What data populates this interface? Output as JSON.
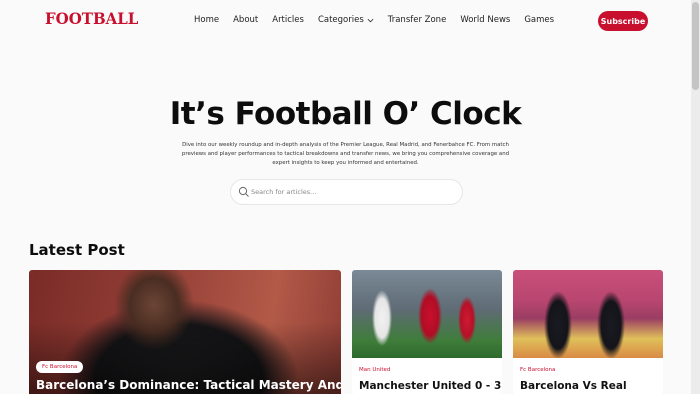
{
  "brand": {
    "logo_text": "FOOTBALL",
    "accent_color": "#c8102e"
  },
  "nav": {
    "items": [
      {
        "label": "Home"
      },
      {
        "label": "About"
      },
      {
        "label": "Articles"
      },
      {
        "label": "Categories",
        "icon": "chevron-down-icon"
      },
      {
        "label": "Transfer Zone"
      },
      {
        "label": "World News"
      },
      {
        "label": "Games"
      }
    ],
    "subscribe_label": "Subscribe"
  },
  "hero": {
    "title": "It’s Football O’ Clock",
    "description": "Dive into our weekly roundup and in-depth analysis of the Premier League, Real Madrid, and Fenerbahce FC. From match previews and player performances to tactical breakdowns and transfer news, we bring you comprehensive coverage and expert insights to keep you informed and entertained.",
    "search": {
      "placeholder": "Search for articles...",
      "icon": "search-icon"
    }
  },
  "latest": {
    "heading": "Latest Post",
    "featured": {
      "tag": "Fc Barcelona",
      "title": "Barcelona’s Dominance: Tactical Mastery And"
    },
    "cards": [
      {
        "tag": "Man United",
        "title": "Manchester United 0 - 3"
      },
      {
        "tag": "Fc Barcelona",
        "title": "Barcelona Vs Real"
      }
    ]
  }
}
